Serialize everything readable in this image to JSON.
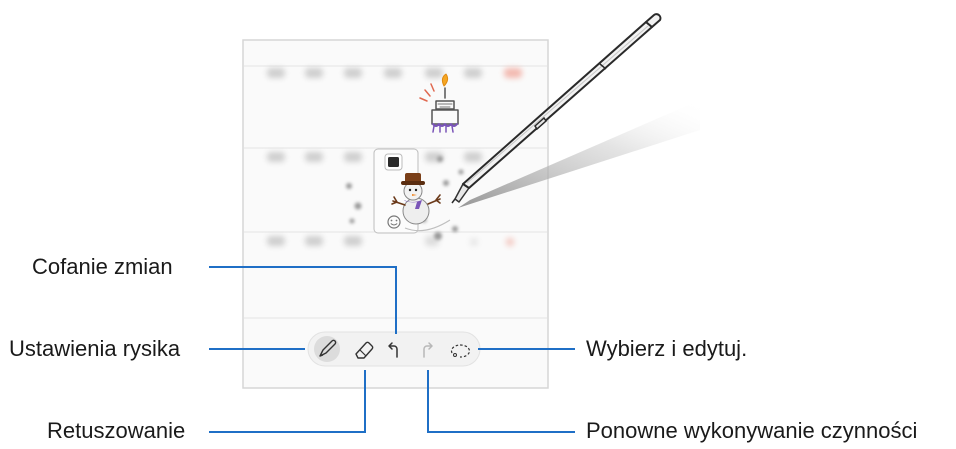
{
  "callouts": {
    "undo": "Cofanie zmian",
    "pen_settings": "Ustawienia rysika",
    "eraser": "Retuszowanie",
    "select_edit": "Wybierz i edytuj.",
    "redo": "Ponowne wykonywanie czynności"
  },
  "toolbar": {
    "items": [
      "pen-settings-icon",
      "eraser-icon",
      "undo-icon",
      "redo-icon",
      "lasso-select-icon"
    ],
    "undo_enabled": true,
    "redo_enabled": false
  },
  "colors": {
    "accent": "#1f6fc6",
    "sketch_ink": "#555555",
    "scarf": "#7a55b8",
    "hat": "#7a3f18",
    "cake_flame": "#f5a623",
    "pen_body": "#f2f2f2"
  },
  "sticker_icons": [
    "color-swatch-icon",
    "emoji-icon"
  ]
}
